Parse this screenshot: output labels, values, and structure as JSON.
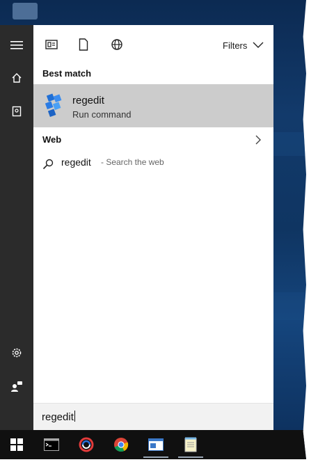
{
  "filter_bar": {
    "icons": [
      "documents-filter-icon",
      "file-filter-icon",
      "web-filter-icon"
    ],
    "filters_label": "Filters"
  },
  "best_match": {
    "heading": "Best match",
    "app_name": "regedit",
    "app_type": "Run command",
    "app_icon": "regedit-icon"
  },
  "web": {
    "heading": "Web",
    "result_term": "regedit",
    "result_hint": "- Search the web"
  },
  "search_box": {
    "value": "regedit"
  },
  "left_rail": {
    "icons": [
      "hamburger-menu-icon",
      "home-icon",
      "notebook-icon",
      "settings-icon",
      "feedback-icon"
    ]
  },
  "taskbar": {
    "icons": [
      "windows-start-icon",
      "command-prompt-icon",
      "sync-app-icon",
      "chrome-icon",
      "window-app-icon",
      "notepad-icon"
    ]
  },
  "colors": {
    "accent_highlight": "#cccccc",
    "rail": "#2b2b2b",
    "taskbar": "#101010"
  }
}
